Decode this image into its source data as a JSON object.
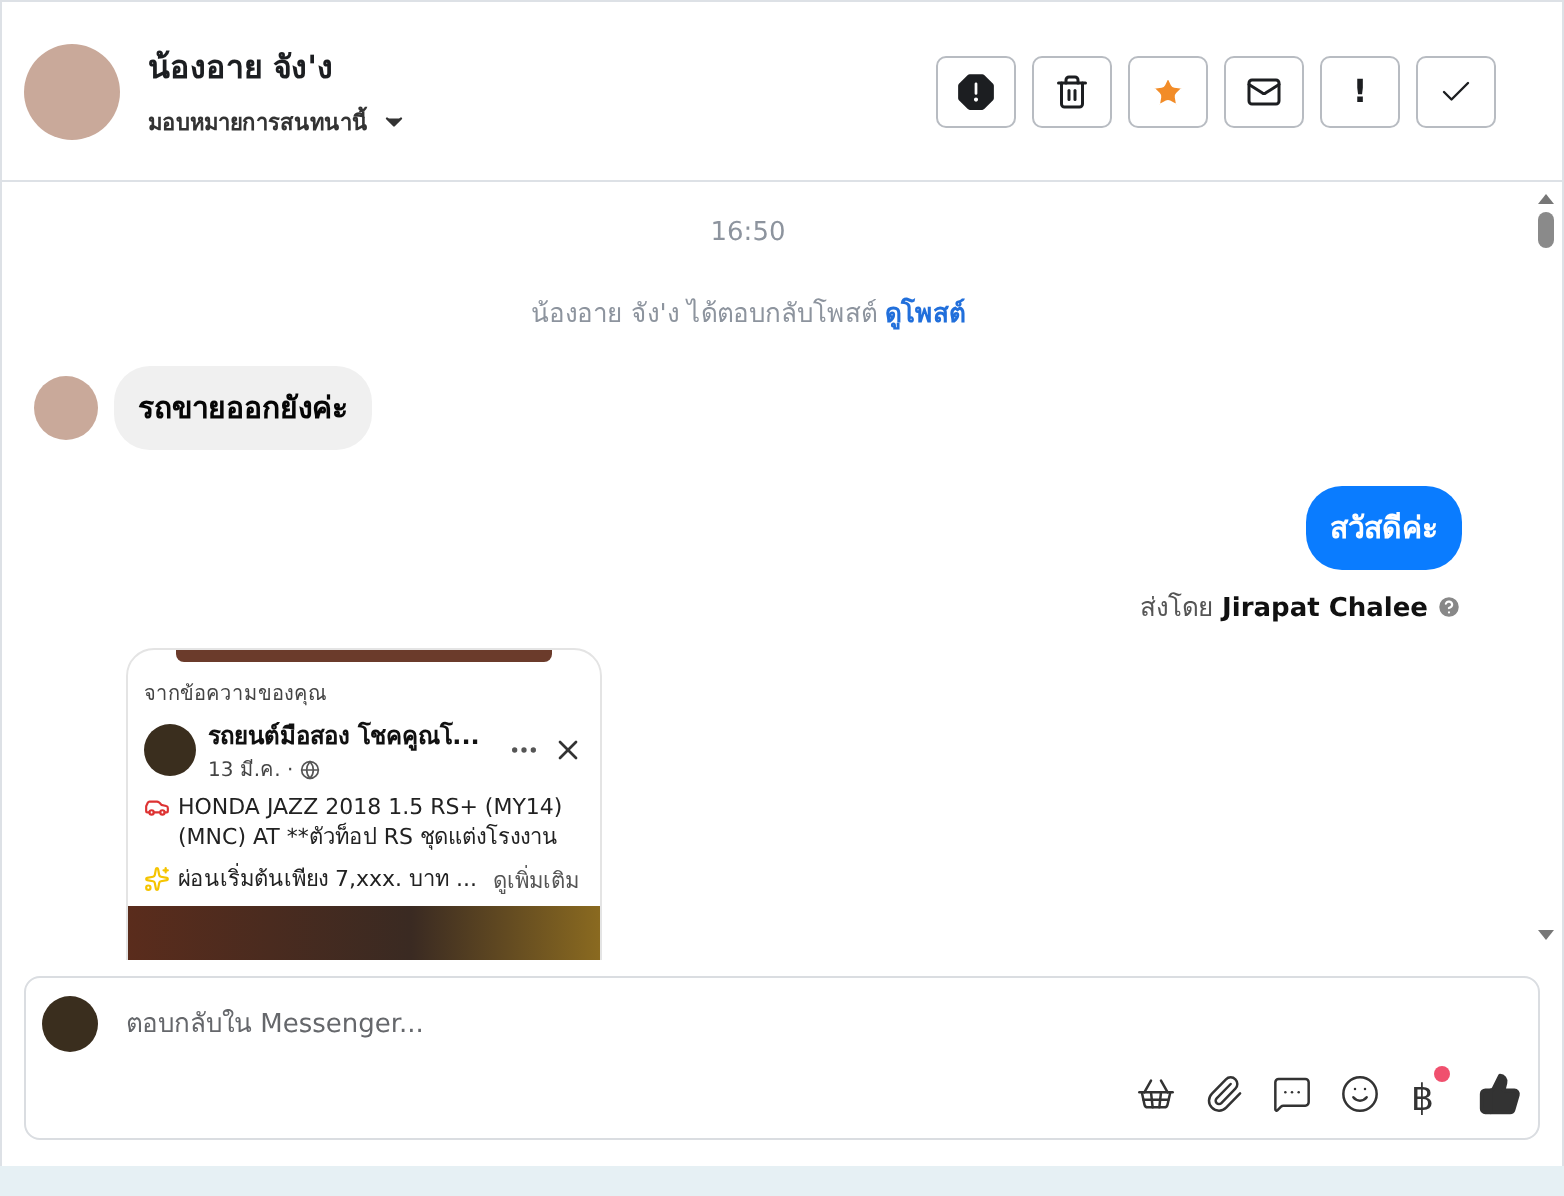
{
  "header": {
    "name": "น้องอาย จัง'ง",
    "assign_label": "มอบหมายการสนทนานี้",
    "actions": [
      {
        "kind": "alert",
        "on": false
      },
      {
        "kind": "trash",
        "on": false
      },
      {
        "kind": "star",
        "on": true
      },
      {
        "kind": "mail",
        "on": false
      },
      {
        "kind": "text",
        "label": "!",
        "on": false
      },
      {
        "kind": "check",
        "on": false
      }
    ]
  },
  "chat": {
    "timestamp": "16:50",
    "notice": {
      "text": "น้องอาย จัง'ง ได้ตอบกลับโพสต์",
      "link": "ดูโพสต์"
    },
    "messages": [
      {
        "kind": "incoming",
        "text": "รถขายออกยังค่ะ"
      },
      {
        "kind": "outgoing",
        "text": "สวัสดีค่ะ",
        "sent_by_label": "ส่งโดย",
        "sent_by": "Jirapat Chalee"
      }
    ],
    "shared_post": {
      "label": "จากข้อความของคุณ",
      "page_name": "รถยนต์มือสอง โชคคูณโ...",
      "date": "13 มี.ค. ·",
      "line_1": "HONDA JAZZ 2018 1.5 RS+ (MY14) (MNC) AT **ตัวท็อป RS ชุดแต่งโรงงาน",
      "line_2": "ผ่อนเริ่มต้นเพียง 7,xxx. บาท ...",
      "see_more": "ดูเพิ่มเติม"
    }
  },
  "composer": {
    "placeholder": "ตอบกลับใน Messenger...",
    "currency": "฿",
    "currency_badge": true
  }
}
